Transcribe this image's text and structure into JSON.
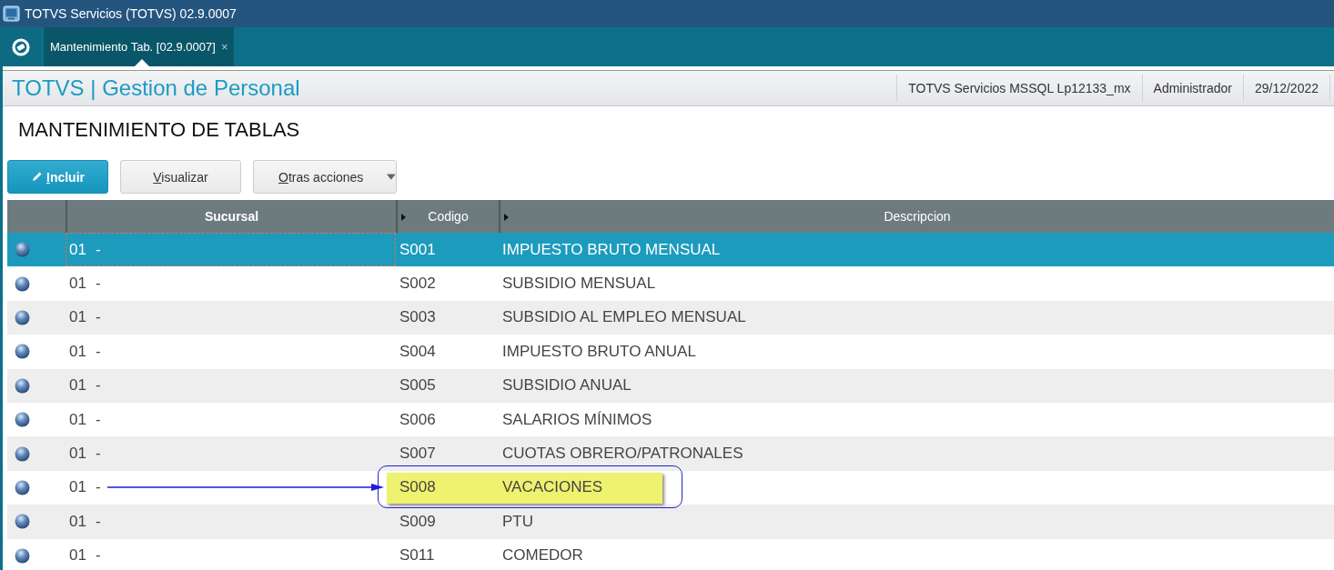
{
  "window": {
    "title": "TOTVS Servicios (TOTVS) 02.9.0007"
  },
  "tabs": [
    {
      "label": "Mantenimiento Tab. [02.9.0007]",
      "close": "×",
      "selected": true
    }
  ],
  "header": {
    "app_title": "TOTVS | Gestion de Personal",
    "environment": "TOTVS Servicios MSSQL Lp12133_mx",
    "user": "Administrador",
    "date": "29/12/2022"
  },
  "page_title": "MANTENIMIENTO DE TABLAS",
  "buttons": [
    {
      "label": "Incluir",
      "kind": "primary"
    },
    {
      "label": "Visualizar",
      "kind": "plain"
    },
    {
      "label": "Otras acciones",
      "kind": "dropdown"
    }
  ],
  "table": {
    "columns": [
      {
        "label": "Sucursal",
        "bold": true,
        "sort_marker": false
      },
      {
        "label": "Codigo",
        "bold": false,
        "sort_marker": true
      },
      {
        "label": "Descripcion",
        "bold": false,
        "sort_marker": true
      }
    ],
    "rows": [
      {
        "sucursal": "01",
        "sep": "-",
        "codigo": "S001",
        "descripcion": "IMPUESTO BRUTO MENSUAL",
        "selected": true,
        "highlighted": false
      },
      {
        "sucursal": "01",
        "sep": "-",
        "codigo": "S002",
        "descripcion": "SUBSIDIO MENSUAL",
        "selected": false,
        "highlighted": false
      },
      {
        "sucursal": "01",
        "sep": "-",
        "codigo": "S003",
        "descripcion": "SUBSIDIO AL EMPLEO MENSUAL",
        "selected": false,
        "highlighted": false
      },
      {
        "sucursal": "01",
        "sep": "-",
        "codigo": "S004",
        "descripcion": "IMPUESTO BRUTO ANUAL",
        "selected": false,
        "highlighted": false
      },
      {
        "sucursal": "01",
        "sep": "-",
        "codigo": "S005",
        "descripcion": "SUBSIDIO ANUAL",
        "selected": false,
        "highlighted": false
      },
      {
        "sucursal": "01",
        "sep": "-",
        "codigo": "S006",
        "descripcion": "SALARIOS MÍNIMOS",
        "selected": false,
        "highlighted": false
      },
      {
        "sucursal": "01",
        "sep": "-",
        "codigo": "S007",
        "descripcion": "CUOTAS OBRERO/PATRONALES",
        "selected": false,
        "highlighted": false
      },
      {
        "sucursal": "01",
        "sep": "-",
        "codigo": "S008",
        "descripcion": "VACACIONES",
        "selected": false,
        "highlighted": true
      },
      {
        "sucursal": "01",
        "sep": "-",
        "codigo": "S009",
        "descripcion": "PTU",
        "selected": false,
        "highlighted": false
      },
      {
        "sucursal": "01",
        "sep": "-",
        "codigo": "S011",
        "descripcion": "COMEDOR",
        "selected": false,
        "highlighted": false
      }
    ]
  }
}
